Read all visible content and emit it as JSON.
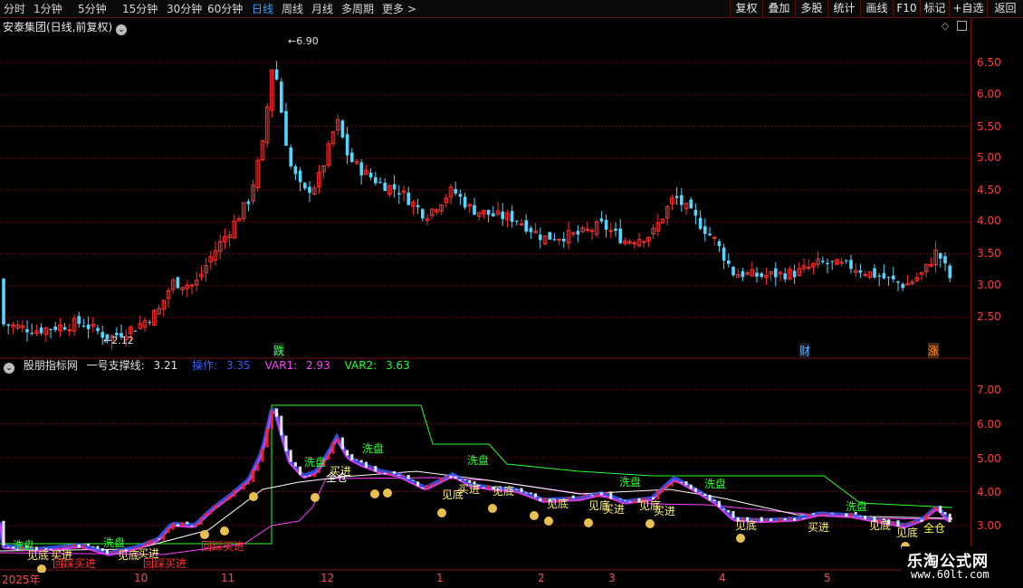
{
  "toolbar": {
    "periods": [
      "分时",
      "1分钟",
      "5分钟",
      "15分钟",
      "30分钟",
      "60分钟",
      "日线",
      "周线",
      "月线",
      "多周期",
      "更多 >"
    ],
    "active_period": "日线",
    "right_buttons": [
      "复权",
      "叠加",
      "多股",
      "统计",
      "画线",
      "F10",
      "标记",
      "+自选",
      "返回"
    ]
  },
  "stock": {
    "title": "安泰集团(日线,前复权)",
    "peak_label": "6.90",
    "low_label": "2.12",
    "event_markers": [
      "跌",
      "财",
      "涨"
    ]
  },
  "price_axis": [
    "6.50",
    "6.00",
    "5.50",
    "5.00",
    "4.50",
    "4.00",
    "3.50",
    "3.00",
    "2.50"
  ],
  "indicator": {
    "name": "股朋指标网",
    "line_label": "一号支撑线:",
    "line_value": "3.21",
    "op_label": "操作:",
    "op_value": "3.35",
    "var1_label": "VAR1:",
    "var1_value": "2.93",
    "var2_label": "VAR2:",
    "var2_value": "3.63",
    "axis": [
      "7.00",
      "6.00",
      "5.00",
      "4.00",
      "3.00"
    ],
    "signal_texts": [
      "洗盘",
      "见底",
      "买进",
      "回踩买进",
      "全仓"
    ]
  },
  "dates": [
    "2025年",
    "10",
    "11",
    "12",
    "1",
    "2",
    "3",
    "4",
    "5"
  ],
  "watermark": {
    "title": "乐淘公式网",
    "url": "www.60lt.com"
  },
  "colors": {
    "up": "#ff3030",
    "down": "#54d6ff",
    "grid": "#7a1414",
    "support_line": "#ffffff",
    "var1_line": "#ff40ff",
    "var2_line": "#2aff2a",
    "op_line": "#3a5cff"
  }
}
